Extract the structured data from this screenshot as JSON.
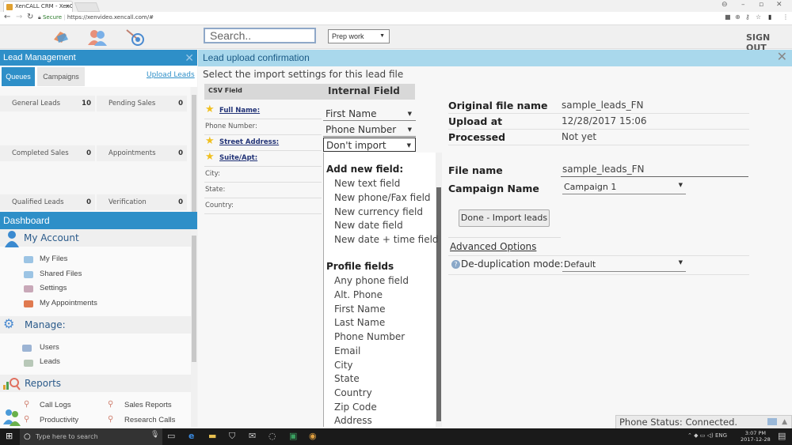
{
  "browser": {
    "tab_title": "XenCALL CRM - XenCALL",
    "secure_label": "Secure",
    "url": "https://xenvideo.xencall.com/#"
  },
  "header": {
    "search_placeholder": "Search..",
    "status_select": "Prep work",
    "sign_out": "SIGN OUT"
  },
  "lead_management": {
    "title": "Lead Management",
    "tabs": [
      "Queues",
      "Campaigns"
    ],
    "upload_link": "Upload Leads",
    "queues": [
      {
        "label": "General Leads",
        "count": "10"
      },
      {
        "label": "Pending Sales",
        "count": "0"
      },
      {
        "label": "Completed Sales",
        "count": "0"
      },
      {
        "label": "Appointments",
        "count": "0"
      },
      {
        "label": "Qualified Leads",
        "count": "0"
      },
      {
        "label": "Verification",
        "count": "0"
      }
    ]
  },
  "dashboard": {
    "title": "Dashboard",
    "sections": {
      "account": {
        "title": "My Account",
        "items": [
          "My Files",
          "Shared Files",
          "Settings",
          "My Appointments"
        ]
      },
      "manage": {
        "title": "Manage:",
        "items": [
          "Users",
          "Leads"
        ]
      },
      "reports": {
        "title": "Reports",
        "items": [
          "Call Logs",
          "Sales Reports",
          "Productivity",
          "Research Calls"
        ]
      }
    }
  },
  "main": {
    "title": "Lead upload confirmation",
    "instruction": "Select the import settings for this lead file",
    "csv_header": "CSV Field",
    "internal_header": "Internal Field",
    "fields": [
      {
        "label": "Full Name:",
        "starred": true,
        "mapping": "First Name"
      },
      {
        "label": "Phone Number:",
        "starred": false,
        "mapping": "Phone Number"
      },
      {
        "label": "Street Address:",
        "starred": true,
        "mapping": "Don't import"
      },
      {
        "label": "Suite/Apt:",
        "starred": true
      },
      {
        "label": "City:",
        "starred": false
      },
      {
        "label": "State:",
        "starred": false
      },
      {
        "label": "Country:",
        "starred": false
      }
    ],
    "dropdown": {
      "group1_title": "Add new field:",
      "group1": [
        "New text field",
        "New phone/Fax field",
        "New currency field",
        "New date field",
        "New date + time field"
      ],
      "group2_title": "Profile fields",
      "group2": [
        "Any phone field",
        "Alt. Phone",
        "First Name",
        "Last Name",
        "Phone Number",
        "Email",
        "City",
        "State",
        "Country",
        "Zip Code",
        "Address"
      ]
    },
    "info": {
      "original_file_name_label": "Original file name",
      "original_file_name": "sample_leads_FN",
      "upload_at_label": "Upload at",
      "upload_at": "12/28/2017 15:06",
      "processed_label": "Processed",
      "processed": "Not yet",
      "file_name_label": "File name",
      "file_name": "sample_leads_FN",
      "campaign_label": "Campaign Name",
      "campaign": "Campaign 1",
      "done_button": "Done - Import leads",
      "advanced_options": "Advanced Options",
      "dedup_label": "De-duplication mode:",
      "dedup_value": "Default"
    },
    "phone_status": "Phone Status: Connected."
  },
  "taskbar": {
    "search_placeholder": "Type here to search",
    "lang": "ENG",
    "time": "3:07 PM",
    "date": "2017-12-28"
  }
}
